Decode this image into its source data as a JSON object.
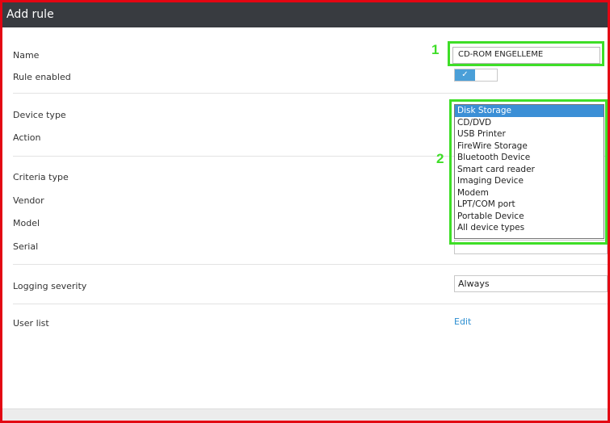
{
  "window": {
    "title": "Add rule"
  },
  "form": {
    "name_label": "Name",
    "name_value": "CD-ROM ENGELLEME",
    "rule_enabled_label": "Rule enabled",
    "rule_enabled_check": "✓",
    "device_type_label": "Device type",
    "action_label": "Action",
    "criteria_type_label": "Criteria type",
    "vendor_label": "Vendor",
    "model_label": "Model",
    "serial_label": "Serial",
    "logging_severity_label": "Logging severity",
    "logging_severity_value": "Always",
    "user_list_label": "User list",
    "user_list_edit": "Edit"
  },
  "device_types": [
    "Disk Storage",
    "CD/DVD",
    "USB Printer",
    "FireWire Storage",
    "Bluetooth Device",
    "Smart card reader",
    "Imaging Device",
    "Modem",
    "LPT/COM port",
    "Portable Device",
    "All device types"
  ],
  "selected_device_type": "Disk Storage",
  "annotations": {
    "one": "1",
    "two": "2"
  },
  "colors": {
    "highlight": "#3ede27",
    "frame_border": "#e30613",
    "titlebar": "#383b40",
    "selection": "#3b8fd6",
    "link": "#2b8ed1"
  }
}
